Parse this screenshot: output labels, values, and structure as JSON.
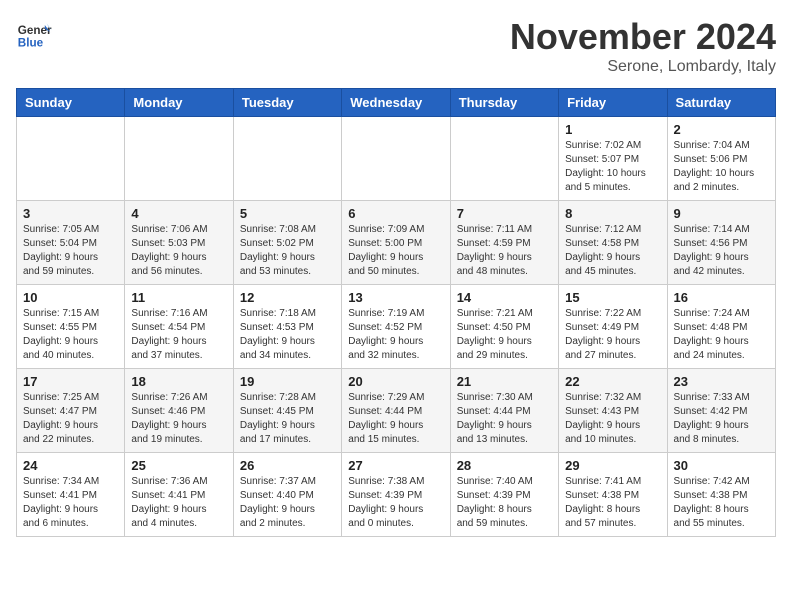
{
  "header": {
    "logo_line1": "General",
    "logo_line2": "Blue",
    "month": "November 2024",
    "location": "Serone, Lombardy, Italy"
  },
  "weekdays": [
    "Sunday",
    "Monday",
    "Tuesday",
    "Wednesday",
    "Thursday",
    "Friday",
    "Saturday"
  ],
  "weeks": [
    [
      {
        "day": "",
        "info": ""
      },
      {
        "day": "",
        "info": ""
      },
      {
        "day": "",
        "info": ""
      },
      {
        "day": "",
        "info": ""
      },
      {
        "day": "",
        "info": ""
      },
      {
        "day": "1",
        "info": "Sunrise: 7:02 AM\nSunset: 5:07 PM\nDaylight: 10 hours\nand 5 minutes."
      },
      {
        "day": "2",
        "info": "Sunrise: 7:04 AM\nSunset: 5:06 PM\nDaylight: 10 hours\nand 2 minutes."
      }
    ],
    [
      {
        "day": "3",
        "info": "Sunrise: 7:05 AM\nSunset: 5:04 PM\nDaylight: 9 hours\nand 59 minutes."
      },
      {
        "day": "4",
        "info": "Sunrise: 7:06 AM\nSunset: 5:03 PM\nDaylight: 9 hours\nand 56 minutes."
      },
      {
        "day": "5",
        "info": "Sunrise: 7:08 AM\nSunset: 5:02 PM\nDaylight: 9 hours\nand 53 minutes."
      },
      {
        "day": "6",
        "info": "Sunrise: 7:09 AM\nSunset: 5:00 PM\nDaylight: 9 hours\nand 50 minutes."
      },
      {
        "day": "7",
        "info": "Sunrise: 7:11 AM\nSunset: 4:59 PM\nDaylight: 9 hours\nand 48 minutes."
      },
      {
        "day": "8",
        "info": "Sunrise: 7:12 AM\nSunset: 4:58 PM\nDaylight: 9 hours\nand 45 minutes."
      },
      {
        "day": "9",
        "info": "Sunrise: 7:14 AM\nSunset: 4:56 PM\nDaylight: 9 hours\nand 42 minutes."
      }
    ],
    [
      {
        "day": "10",
        "info": "Sunrise: 7:15 AM\nSunset: 4:55 PM\nDaylight: 9 hours\nand 40 minutes."
      },
      {
        "day": "11",
        "info": "Sunrise: 7:16 AM\nSunset: 4:54 PM\nDaylight: 9 hours\nand 37 minutes."
      },
      {
        "day": "12",
        "info": "Sunrise: 7:18 AM\nSunset: 4:53 PM\nDaylight: 9 hours\nand 34 minutes."
      },
      {
        "day": "13",
        "info": "Sunrise: 7:19 AM\nSunset: 4:52 PM\nDaylight: 9 hours\nand 32 minutes."
      },
      {
        "day": "14",
        "info": "Sunrise: 7:21 AM\nSunset: 4:50 PM\nDaylight: 9 hours\nand 29 minutes."
      },
      {
        "day": "15",
        "info": "Sunrise: 7:22 AM\nSunset: 4:49 PM\nDaylight: 9 hours\nand 27 minutes."
      },
      {
        "day": "16",
        "info": "Sunrise: 7:24 AM\nSunset: 4:48 PM\nDaylight: 9 hours\nand 24 minutes."
      }
    ],
    [
      {
        "day": "17",
        "info": "Sunrise: 7:25 AM\nSunset: 4:47 PM\nDaylight: 9 hours\nand 22 minutes."
      },
      {
        "day": "18",
        "info": "Sunrise: 7:26 AM\nSunset: 4:46 PM\nDaylight: 9 hours\nand 19 minutes."
      },
      {
        "day": "19",
        "info": "Sunrise: 7:28 AM\nSunset: 4:45 PM\nDaylight: 9 hours\nand 17 minutes."
      },
      {
        "day": "20",
        "info": "Sunrise: 7:29 AM\nSunset: 4:44 PM\nDaylight: 9 hours\nand 15 minutes."
      },
      {
        "day": "21",
        "info": "Sunrise: 7:30 AM\nSunset: 4:44 PM\nDaylight: 9 hours\nand 13 minutes."
      },
      {
        "day": "22",
        "info": "Sunrise: 7:32 AM\nSunset: 4:43 PM\nDaylight: 9 hours\nand 10 minutes."
      },
      {
        "day": "23",
        "info": "Sunrise: 7:33 AM\nSunset: 4:42 PM\nDaylight: 9 hours\nand 8 minutes."
      }
    ],
    [
      {
        "day": "24",
        "info": "Sunrise: 7:34 AM\nSunset: 4:41 PM\nDaylight: 9 hours\nand 6 minutes."
      },
      {
        "day": "25",
        "info": "Sunrise: 7:36 AM\nSunset: 4:41 PM\nDaylight: 9 hours\nand 4 minutes."
      },
      {
        "day": "26",
        "info": "Sunrise: 7:37 AM\nSunset: 4:40 PM\nDaylight: 9 hours\nand 2 minutes."
      },
      {
        "day": "27",
        "info": "Sunrise: 7:38 AM\nSunset: 4:39 PM\nDaylight: 9 hours\nand 0 minutes."
      },
      {
        "day": "28",
        "info": "Sunrise: 7:40 AM\nSunset: 4:39 PM\nDaylight: 8 hours\nand 59 minutes."
      },
      {
        "day": "29",
        "info": "Sunrise: 7:41 AM\nSunset: 4:38 PM\nDaylight: 8 hours\nand 57 minutes."
      },
      {
        "day": "30",
        "info": "Sunrise: 7:42 AM\nSunset: 4:38 PM\nDaylight: 8 hours\nand 55 minutes."
      }
    ]
  ]
}
